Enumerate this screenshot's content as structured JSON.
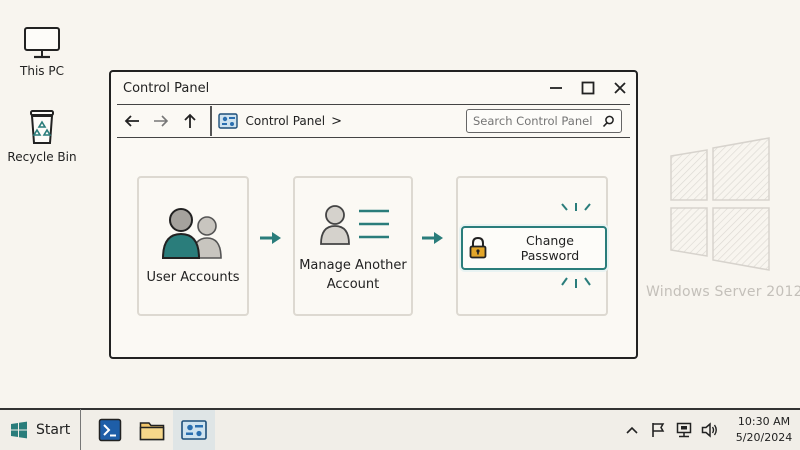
{
  "desktop": {
    "icons": [
      {
        "label": "This PC",
        "icon": "monitor-icon"
      },
      {
        "label": "Recycle Bin",
        "icon": "recycle-bin-icon"
      }
    ],
    "watermark": "Windows Server 2012"
  },
  "window": {
    "title": "Control Panel",
    "controls": {
      "minimize": "minimize-icon",
      "maximize": "maximize-icon",
      "close": "close-icon"
    },
    "breadcrumb": {
      "label": "Control Panel",
      "separator": ">"
    },
    "search": {
      "placeholder": "Search Control Panel"
    }
  },
  "steps": [
    {
      "label": "User Accounts",
      "icon": "users-icon"
    },
    {
      "label": "Manage Another Account",
      "line1": "Manage Another",
      "line2": "Account",
      "icon": "user-list-icon"
    },
    {
      "label": "Change Password",
      "icon": "lock-icon"
    }
  ],
  "taskbar": {
    "start_label": "Start",
    "items": [
      "powershell-icon",
      "file-explorer-icon",
      "control-panel-icon"
    ],
    "tray": [
      "chevron-up-icon",
      "flag-icon",
      "network-icon",
      "speaker-icon"
    ],
    "clock": {
      "time": "10:30 AM",
      "date": "5/20/2024"
    }
  },
  "colors": {
    "accent": "#2a7d7b",
    "background": "#f8f5ef",
    "lock": "#e3a62a"
  }
}
